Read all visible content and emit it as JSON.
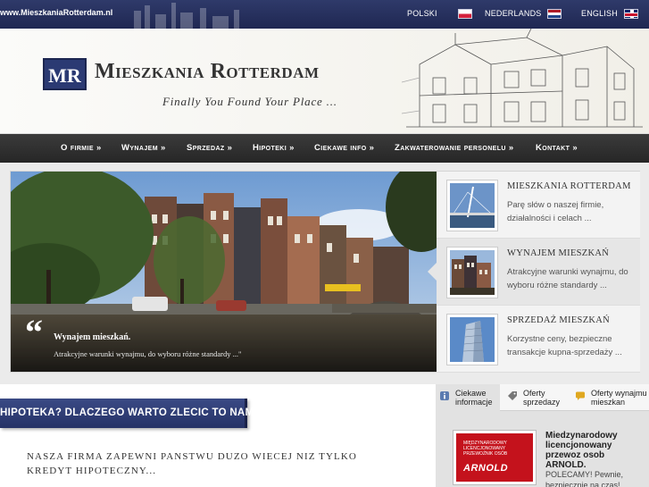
{
  "topbar": {
    "url": "www.MieszkaniaRotterdam.nl",
    "languages": [
      {
        "label": "POLSKI",
        "flag": "flag-pl-icon"
      },
      {
        "label": "NEDERLANDS",
        "flag": "flag-nl-icon"
      },
      {
        "label": "ENGLISH",
        "flag": "flag-en-icon"
      }
    ]
  },
  "header": {
    "logo_mark": "MR",
    "logo_name": "Mieszkania Rotterdam",
    "tagline": "Finally You Found Your Place ..."
  },
  "nav": {
    "items": [
      "O firmie »",
      "Wynajem »",
      "Sprzedaz »",
      "Hipoteki »",
      "Ciekawe info »",
      "Zakwaterowanie personelu »",
      "Kontakt »"
    ]
  },
  "slider": {
    "quote_mark": "“",
    "caption_title": "Wynajem mieszkań.",
    "caption_text": "Atrakcyjne warunki wynajmu, do wyboru różne standardy ...\"",
    "thumbs": [
      {
        "title": "MIESZKANIA ROTTERDAM",
        "text": "Parę słów o naszej firmie, działalności i celach ..."
      },
      {
        "title": "WYNAJEM MIESZKAŃ",
        "text": "Atrakcyjne warunki wynajmu, do wyboru różne standardy ..."
      },
      {
        "title": "SPRZEDAŻ MIESZKAŃ",
        "text": "Korzystne ceny, bezpieczne transakcje kupna-sprzedaży ..."
      }
    ]
  },
  "content": {
    "heading": "HIPOTEKA? DLACZEGO WARTO ZLECIC TO NAM?",
    "intro": "NASZA FIRMA ZAPEWNI PANSTWU DUZO WIECEJ NIZ TYLKO KREDYT HIPOTECZNY..."
  },
  "sidebar": {
    "tabs": [
      {
        "label": "Ciekawe\ninformacje",
        "icon": "info-icon"
      },
      {
        "label": "Oferty\nsprzedazy",
        "icon": "tag-icon"
      },
      {
        "label": "Oferty wynajmu\nmieszkan",
        "icon": "chat-icon"
      }
    ],
    "promo": {
      "image_text": "MIĘDZYNARODOWY\nLICENCJONOWANY\nPRZEWOŹNIK OSÓB",
      "image_logo": "ARNOLD",
      "title": "Miedzynarodowy licencjonowany przewoz osob ARNOLD.",
      "text": "POLECAMY! Pewnie, bezpiecznie na czas!"
    }
  },
  "colors": {
    "topbar": "#1f2752",
    "logo": "#2b3a73",
    "nav": "#262626",
    "promo": "#c4121c"
  }
}
